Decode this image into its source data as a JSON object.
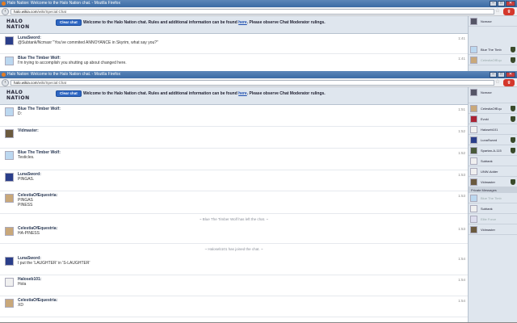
{
  "window_title": "Halo Nation: Welcome to the Halo Nation chat. - Mozilla Firefox",
  "url_host": "halo.wikia.com",
  "url_path": "/wiki/Special:Chat",
  "clear_chat_label": "Clear chat",
  "welcome_prefix": "Welcome to the Halo Nation chat. Rules and additional information can be found",
  "welcome_link": "here",
  "welcome_suffix": ". Please observe Chat Moderator rulings.",
  "logo_text": "HALO NATION",
  "back_window": {
    "messages": [
      {
        "user": "LunaSword:",
        "text": "@Subtank/Ncmaxr \"You've commited ANNOYANCE in Skyrim, what say you?\"",
        "time": "1:41"
      },
      {
        "user": "Blue The Timber Wolf:",
        "text": "I'm trying to accomplish you shutting up about changed here.",
        "time": "1:41"
      }
    ],
    "users": [
      "Ncmaxr",
      "Blue The Timb",
      "CelestiaOfEqu"
    ]
  },
  "front_window": {
    "messages": [
      {
        "user": "Blue The Timber Wolf:",
        "text": "D:",
        "time": "1:51"
      },
      {
        "user": "Vidmaster:",
        "text": "",
        "time": "1:52"
      },
      {
        "user": "Blue The Timber Wolf:",
        "text": "Testicles.",
        "time": "1:52"
      },
      {
        "user": "LunaSword:",
        "text": "PINGAS.",
        "time": "1:53"
      },
      {
        "user": "CelestiaOfEquestria:",
        "text": "PINGAS",
        "text2": "PINESS",
        "time": "1:53"
      },
      {
        "alert": "~ Blue The Timber Wolf has left the chat. ~"
      },
      {
        "user": "CelestiaOfEquestria:",
        "text": "HA-PINESS",
        "time": "1:53"
      },
      {
        "alert": "~ Haloseb101 has joined the chat. ~"
      },
      {
        "user": "LunaSword:",
        "text": "I put the 'LAUGHTER' in 'S-LAUGHTER'",
        "time": "1:54"
      },
      {
        "user": "Haloseb101:",
        "text": "Hola",
        "time": "1:54"
      },
      {
        "user": "CelestiaOfEquestria:",
        "text": "XD",
        "time": "1:54"
      }
    ],
    "users": [
      "Ncmaxr",
      "CelestiaOfEqu",
      "Evoki",
      "Haloseb101",
      "LunaSword",
      "Spartan-A-115",
      "Subtank",
      "UNW-Adder",
      "Vidmaster"
    ],
    "private_messages_label": "Private Messages",
    "pm_users": [
      "Blue The Timb",
      "Subtank",
      "Elite Force",
      "Vidmaster"
    ]
  },
  "colors": {
    "titlebar": "#3a6aa5",
    "clear_button": "#2d66c3",
    "chat_header": "#dfe6ee"
  }
}
